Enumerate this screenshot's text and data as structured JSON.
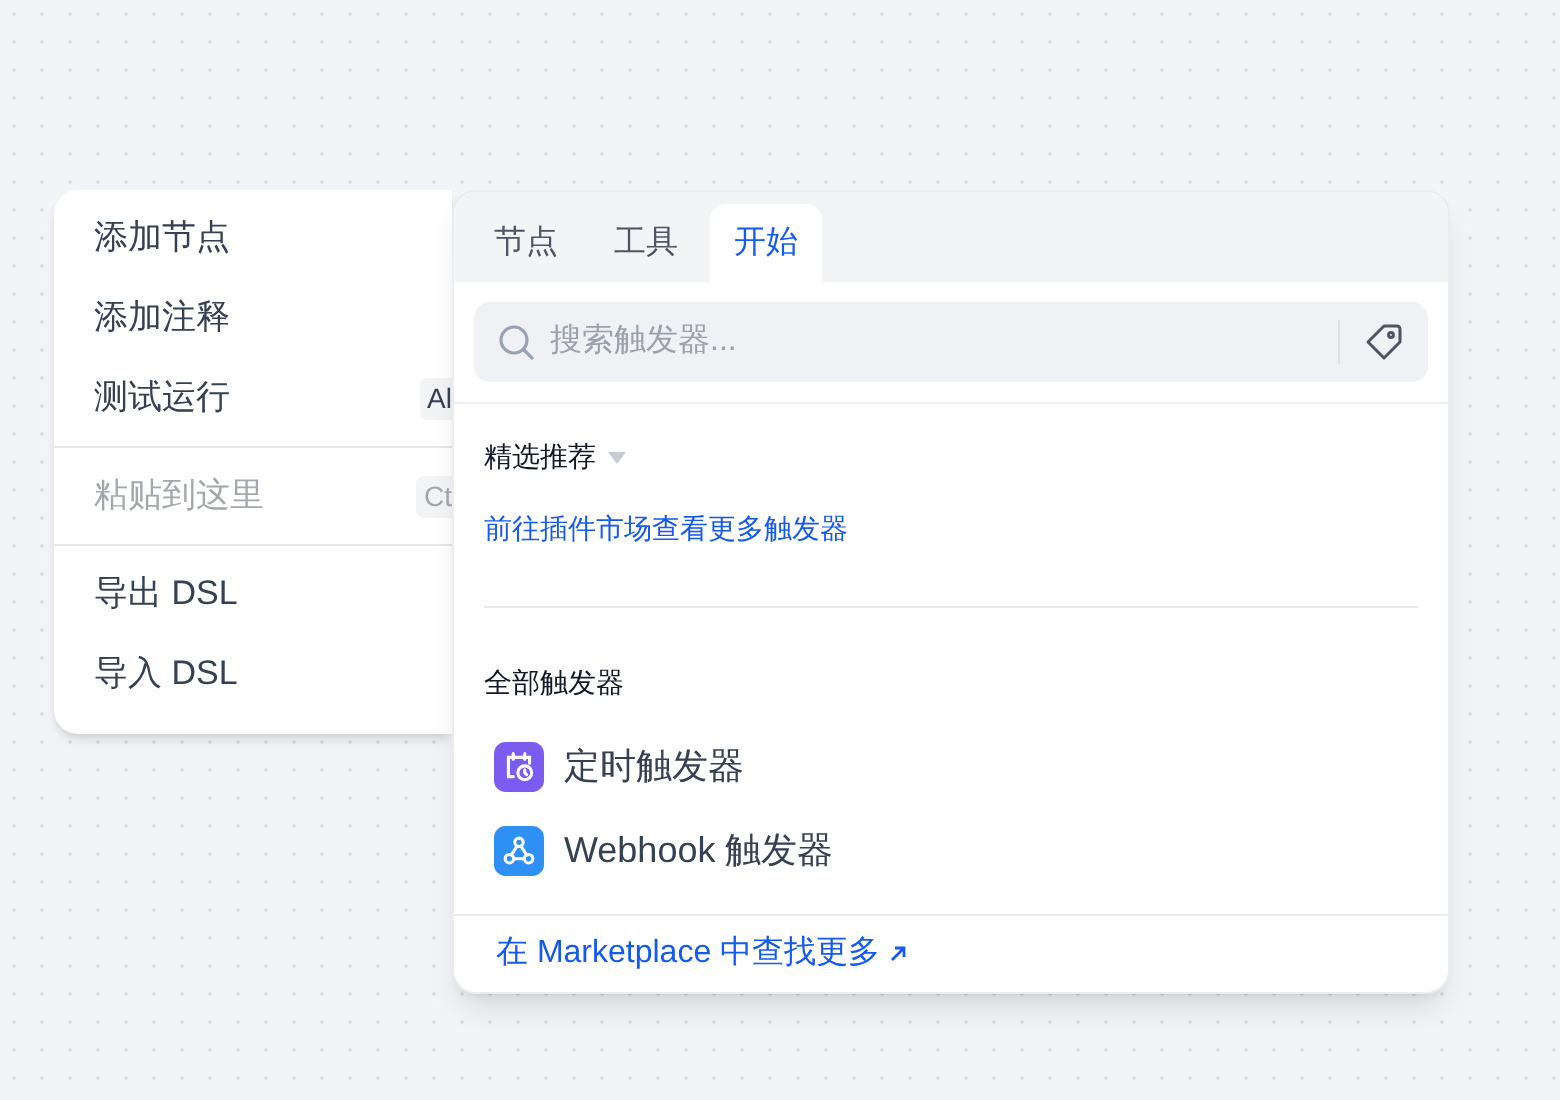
{
  "context_menu": {
    "groups": [
      {
        "items": [
          {
            "label": "添加节点",
            "disabled": false
          },
          {
            "label": "添加注释",
            "disabled": false
          },
          {
            "label": "测试运行",
            "shortcut": "Al",
            "disabled": false
          }
        ]
      },
      {
        "items": [
          {
            "label": "粘贴到这里",
            "shortcut": "Ct",
            "disabled": true
          }
        ]
      },
      {
        "items": [
          {
            "label": "导出 DSL",
            "disabled": false
          },
          {
            "label": "导入 DSL",
            "disabled": false
          }
        ]
      }
    ]
  },
  "panel": {
    "tabs": [
      {
        "label": "节点",
        "selected": false
      },
      {
        "label": "工具",
        "selected": false
      },
      {
        "label": "开始",
        "selected": true
      }
    ],
    "search": {
      "placeholder": "搜索触发器..."
    },
    "featured": {
      "title": "精选推荐",
      "link": "前往插件市场查看更多触发器"
    },
    "all": {
      "title": "全部触发器",
      "items": [
        {
          "label": "定时触发器",
          "kind": "schedule",
          "color": "#7c5cf0"
        },
        {
          "label": "Webhook 触发器",
          "kind": "webhook",
          "color": "#2e8ff5"
        }
      ]
    },
    "footer_link": "在 Marketplace 中查找更多"
  }
}
